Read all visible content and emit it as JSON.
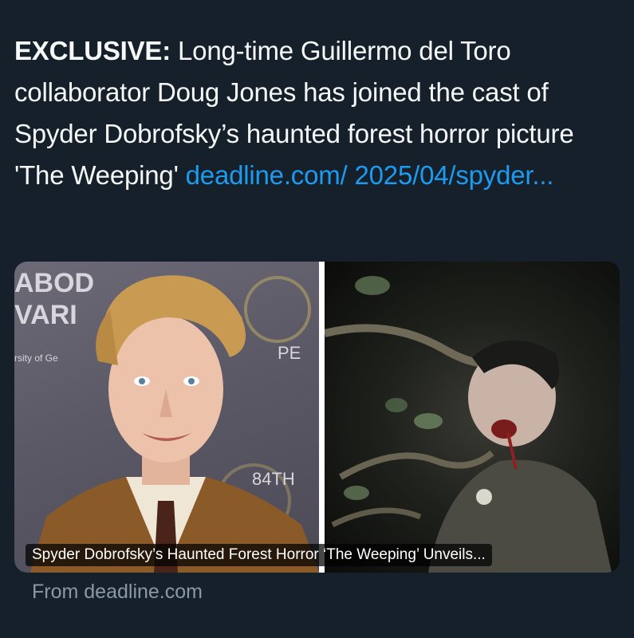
{
  "tweet": {
    "lead": "EXCLUSIVE:",
    "body": " Long-time Guillermo del Toro collaborator Doug Jones has joined the cast of Spyder Dobrofsky’s haunted forest horror picture 'The Weeping' ",
    "link": "deadline.com/ 2025/04/spyder..."
  },
  "card": {
    "title": "Spyder Dobrofsky’s Haunted Forest Horror ‘The Weeping’ Unveils...",
    "backdrop_left": {
      "line1": "ABOD",
      "line2": "VARI",
      "line3": "rsity of Ge",
      "line4": "PE",
      "line5": "84TH"
    }
  },
  "source": {
    "label": "From deadline.com"
  }
}
